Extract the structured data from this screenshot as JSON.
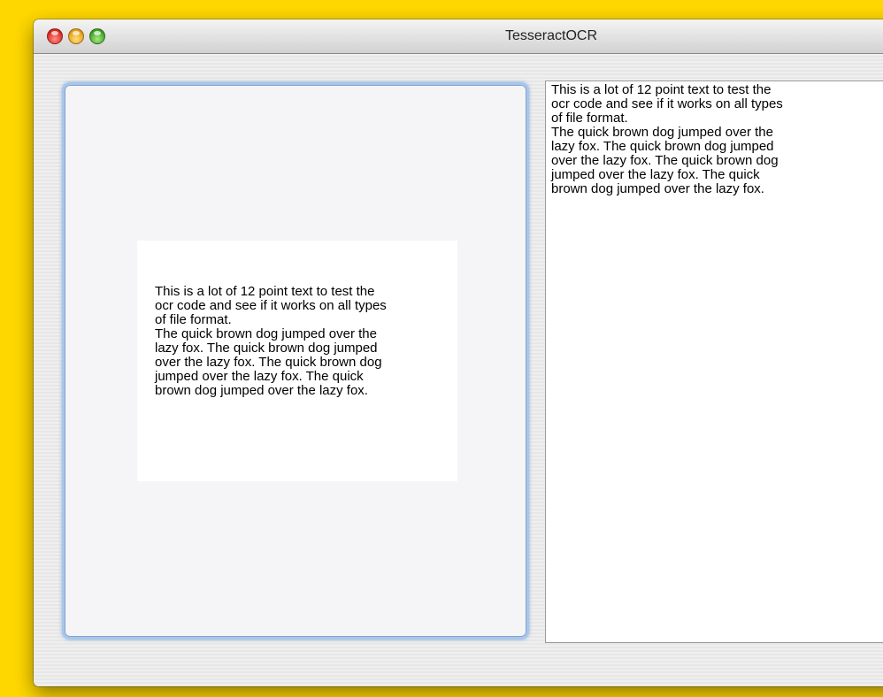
{
  "window": {
    "title": "TesseractOCR"
  },
  "image_well": {
    "image_text": "This is a lot of 12 point text to test the\nocr code and see if it works on  all types\nof file format.\nThe quick brown dog jumped over the\nlazy fox. The quick brown dog jumped\nover the lazy fox. The quick brown dog\n jumped over the lazy fox. The quick\nbrown dog jumped over the lazy fox."
  },
  "output": {
    "text": "This is a lot of 12 point text to test the\nocr code and see if it works on all types\nof file format.\nThe quick brown dog jumped over the\nlazy fox. The quick brown dog jumped\nover the lazy fox. The quick brown dog\njumped over the lazy fox. The quick\nbrown dog jumped over the lazy fox."
  },
  "colors": {
    "desktop_background": "#FFD700",
    "focus_ring": "#a9c6e8",
    "close_button": "#d8251b",
    "minimize_button": "#e59b14",
    "zoom_button": "#3c9d22"
  }
}
